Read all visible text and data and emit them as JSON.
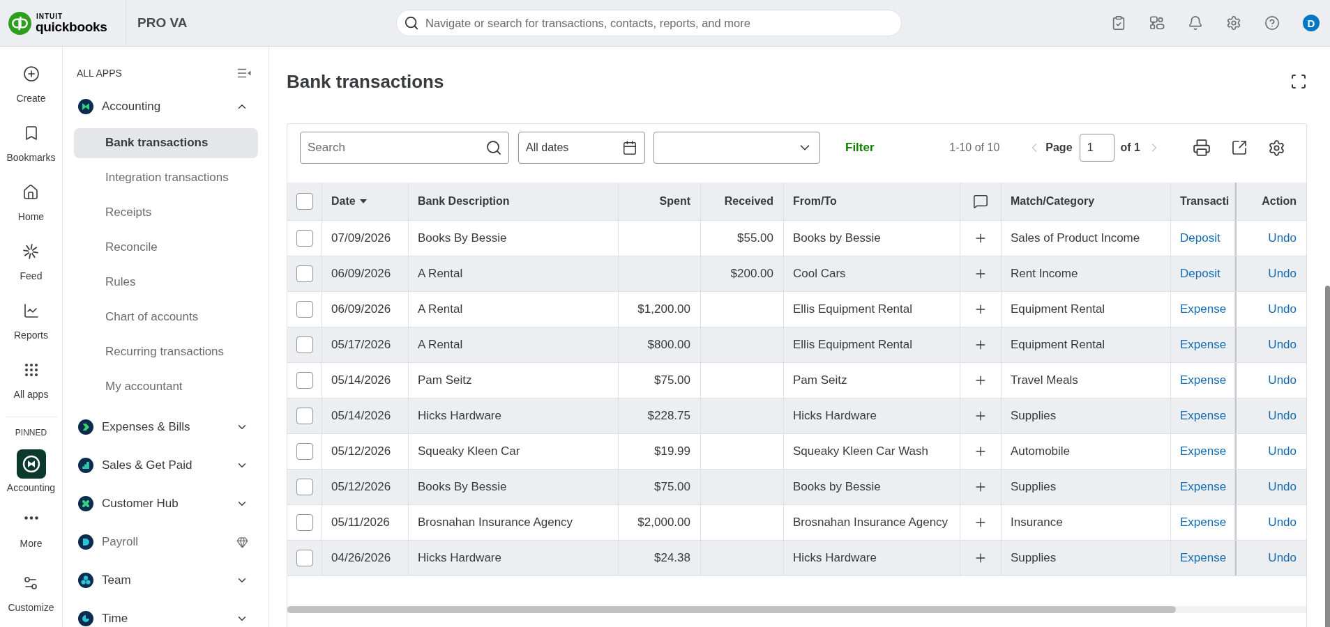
{
  "top_bar": {
    "logo": {
      "company_line": "INTUIT",
      "product_line": "quickbooks"
    },
    "company": "PRO VA",
    "search": {
      "placeholder": "Navigate or search for transactions, contacts, reports, and more"
    },
    "avatar": "D"
  },
  "rail": {
    "items": [
      {
        "label": "Create"
      },
      {
        "label": "Bookmarks"
      },
      {
        "label": "Home"
      },
      {
        "label": "Feed"
      },
      {
        "label": "Reports"
      },
      {
        "label": "All apps"
      }
    ],
    "pinned_heading": "PINNED",
    "pinned": [
      {
        "label": "Accounting"
      }
    ],
    "footer_items": [
      {
        "label": "More"
      },
      {
        "label": "Customize"
      }
    ]
  },
  "sidebar": {
    "heading": "ALL APPS",
    "apps": [
      {
        "kind": "group",
        "label": "Accounting",
        "expanded": true,
        "children": [
          {
            "label": "Bank transactions",
            "selected": true
          },
          {
            "label": "Integration transactions",
            "selected": false
          },
          {
            "label": "Receipts",
            "selected": false
          },
          {
            "label": "Reconcile",
            "selected": false
          },
          {
            "label": "Rules",
            "selected": false
          },
          {
            "label": "Chart of accounts",
            "selected": false
          },
          {
            "label": "Recurring transactions",
            "selected": false
          },
          {
            "label": "My accountant",
            "selected": false
          }
        ]
      },
      {
        "kind": "group",
        "label": "Expenses & Bills",
        "expanded": false
      },
      {
        "kind": "group",
        "label": "Sales & Get Paid",
        "expanded": false
      },
      {
        "kind": "group",
        "label": "Customer Hub",
        "expanded": false
      },
      {
        "kind": "premium",
        "label": "Payroll"
      },
      {
        "kind": "group",
        "label": "Team",
        "expanded": false
      },
      {
        "kind": "group",
        "label": "Time",
        "expanded": false
      }
    ]
  },
  "main": {
    "title": "Bank transactions",
    "toolbar": {
      "search": {
        "placeholder": "Search"
      },
      "date_filter": {
        "value": "All dates"
      },
      "filter_button": "Filter",
      "range": "1-10 of 10",
      "pager": {
        "previous": {
          "disabled": true
        },
        "label": "Page",
        "value": "1",
        "total": "of 1",
        "next": {
          "disabled": true
        }
      }
    },
    "table": {
      "columns": [
        {
          "kind": "select",
          "checked": false
        },
        {
          "kind": "text",
          "label": "Date",
          "sorted": true
        },
        {
          "kind": "text",
          "label": "Bank Description",
          "sorted": false
        },
        {
          "kind": "amount",
          "label": "Spent",
          "sorted": false
        },
        {
          "kind": "amount",
          "label": "Received",
          "sorted": false
        },
        {
          "kind": "text",
          "label": "From/To",
          "sorted": false
        },
        {
          "kind": "comment"
        },
        {
          "kind": "text",
          "label": "Match/Category",
          "sorted": false
        },
        {
          "kind": "link",
          "label": "Transacti",
          "sorted": false
        },
        {
          "kind": "action",
          "label": "Action",
          "sorted": false
        }
      ],
      "rows": [
        {
          "checked": false,
          "date": "07/09/2026",
          "description": "Books By Bessie",
          "received": "$55.00",
          "from_to": "Books by Bessie",
          "category": "Sales of Product Income",
          "transaction": "Deposit",
          "action": "Undo"
        },
        {
          "checked": false,
          "date": "06/09/2026",
          "description": "A Rental",
          "received": "$200.00",
          "from_to": "Cool Cars",
          "category": "Rent Income",
          "transaction": "Deposit",
          "action": "Undo"
        },
        {
          "checked": false,
          "date": "06/09/2026",
          "description": "A Rental",
          "spent": "$1,200.00",
          "from_to": "Ellis Equipment Rental",
          "category": "Equipment Rental",
          "transaction": "Expense",
          "action": "Undo"
        },
        {
          "checked": false,
          "date": "05/17/2026",
          "description": "A Rental",
          "spent": "$800.00",
          "from_to": "Ellis Equipment Rental",
          "category": "Equipment Rental",
          "transaction": "Expense",
          "action": "Undo"
        },
        {
          "checked": false,
          "date": "05/14/2026",
          "description": "Pam Seitz",
          "spent": "$75.00",
          "from_to": "Pam Seitz",
          "category": "Travel Meals",
          "transaction": "Expense",
          "action": "Undo"
        },
        {
          "checked": false,
          "date": "05/14/2026",
          "description": "Hicks Hardware",
          "spent": "$228.75",
          "from_to": "Hicks Hardware",
          "category": "Supplies",
          "transaction": "Expense",
          "action": "Undo"
        },
        {
          "checked": false,
          "date": "05/12/2026",
          "description": "Squeaky Kleen Car",
          "spent": "$19.99",
          "from_to": "Squeaky Kleen Car Wash",
          "category": "Automobile",
          "transaction": "Expense",
          "action": "Undo"
        },
        {
          "checked": false,
          "date": "05/12/2026",
          "description": "Books By Bessie",
          "spent": "$75.00",
          "from_to": "Books by Bessie",
          "category": "Supplies",
          "transaction": "Expense",
          "action": "Undo"
        },
        {
          "checked": false,
          "date": "05/11/2026",
          "description": "Brosnahan Insurance Agency",
          "spent": "$2,000.00",
          "from_to": "Brosnahan Insurance Agency",
          "category": "Insurance",
          "transaction": "Expense",
          "action": "Undo"
        },
        {
          "checked": false,
          "date": "04/26/2026",
          "description": "Hicks Hardware",
          "spent": "$24.38",
          "from_to": "Hicks Hardware",
          "category": "Supplies",
          "transaction": "Expense",
          "action": "Undo"
        }
      ]
    }
  }
}
